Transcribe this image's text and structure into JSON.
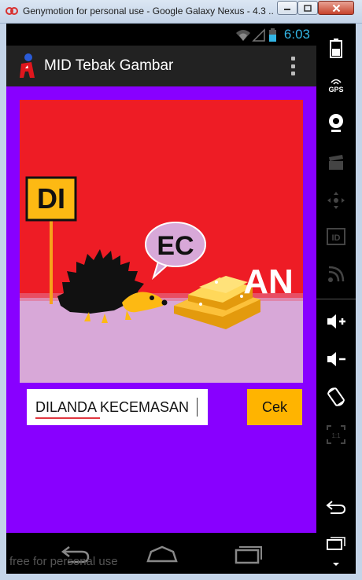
{
  "window": {
    "title": "Genymotion for personal use - Google Galaxy Nexus - 4.3 ...",
    "watermark": "free for personal use"
  },
  "status_bar": {
    "time": "6:03"
  },
  "action_bar": {
    "title": "MID Tebak Gambar"
  },
  "puzzle": {
    "sign_text": "DI",
    "bubble_text": "EC",
    "right_text": "AN"
  },
  "answer": {
    "value": "DILANDA KECEMASAN"
  },
  "check_button": {
    "label": "Cek"
  },
  "side_panel": {
    "gps_label": "GPS",
    "id_label": "ID",
    "pixel_label": "1:1"
  },
  "colors": {
    "content_bg": "#8800ff",
    "puzzle_red": "#ee1c25",
    "puzzle_ground": "#d8a8d8",
    "button": "#ffb400",
    "status_accent": "#33b5e5"
  }
}
